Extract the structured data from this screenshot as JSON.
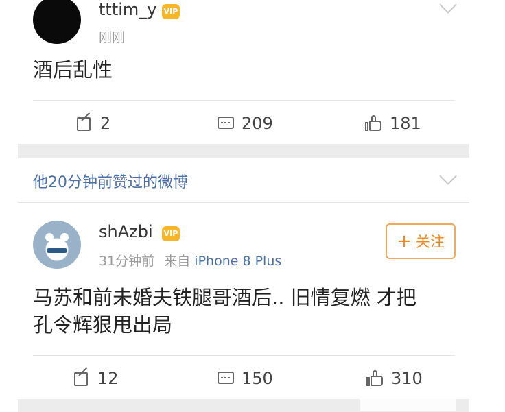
{
  "post1": {
    "username": "tttim_y",
    "badge": "VIP",
    "time": "刚刚",
    "text": "酒后乱性",
    "actions": {
      "share_count": "2",
      "comment_count": "209",
      "like_count": "181"
    }
  },
  "section": {
    "title": "他20分钟前赞过的微博"
  },
  "post2": {
    "username": "shAzbi",
    "badge": "VIP",
    "time": "31分钟前",
    "source_prefix": "来自",
    "device": "iPhone 8 Plus",
    "follow_label": "关注",
    "follow_plus": "+",
    "text_line1": "马苏和前未婚夫铁腿哥酒后.. 旧情复燃 才把",
    "text_line2": "孔令辉狠甩出局",
    "actions": {
      "share_count": "12",
      "comment_count": "150",
      "like_count": "310"
    }
  },
  "colors": {
    "link_blue": "#4a6fa5",
    "follow_orange": "#f08a24",
    "badge_gold": "#f7b62a",
    "separator_gray": "#ececec"
  },
  "icons": [
    "chevron-down-icon",
    "share-icon",
    "comment-icon",
    "like-icon",
    "vip-badge-icon",
    "plus-icon"
  ]
}
